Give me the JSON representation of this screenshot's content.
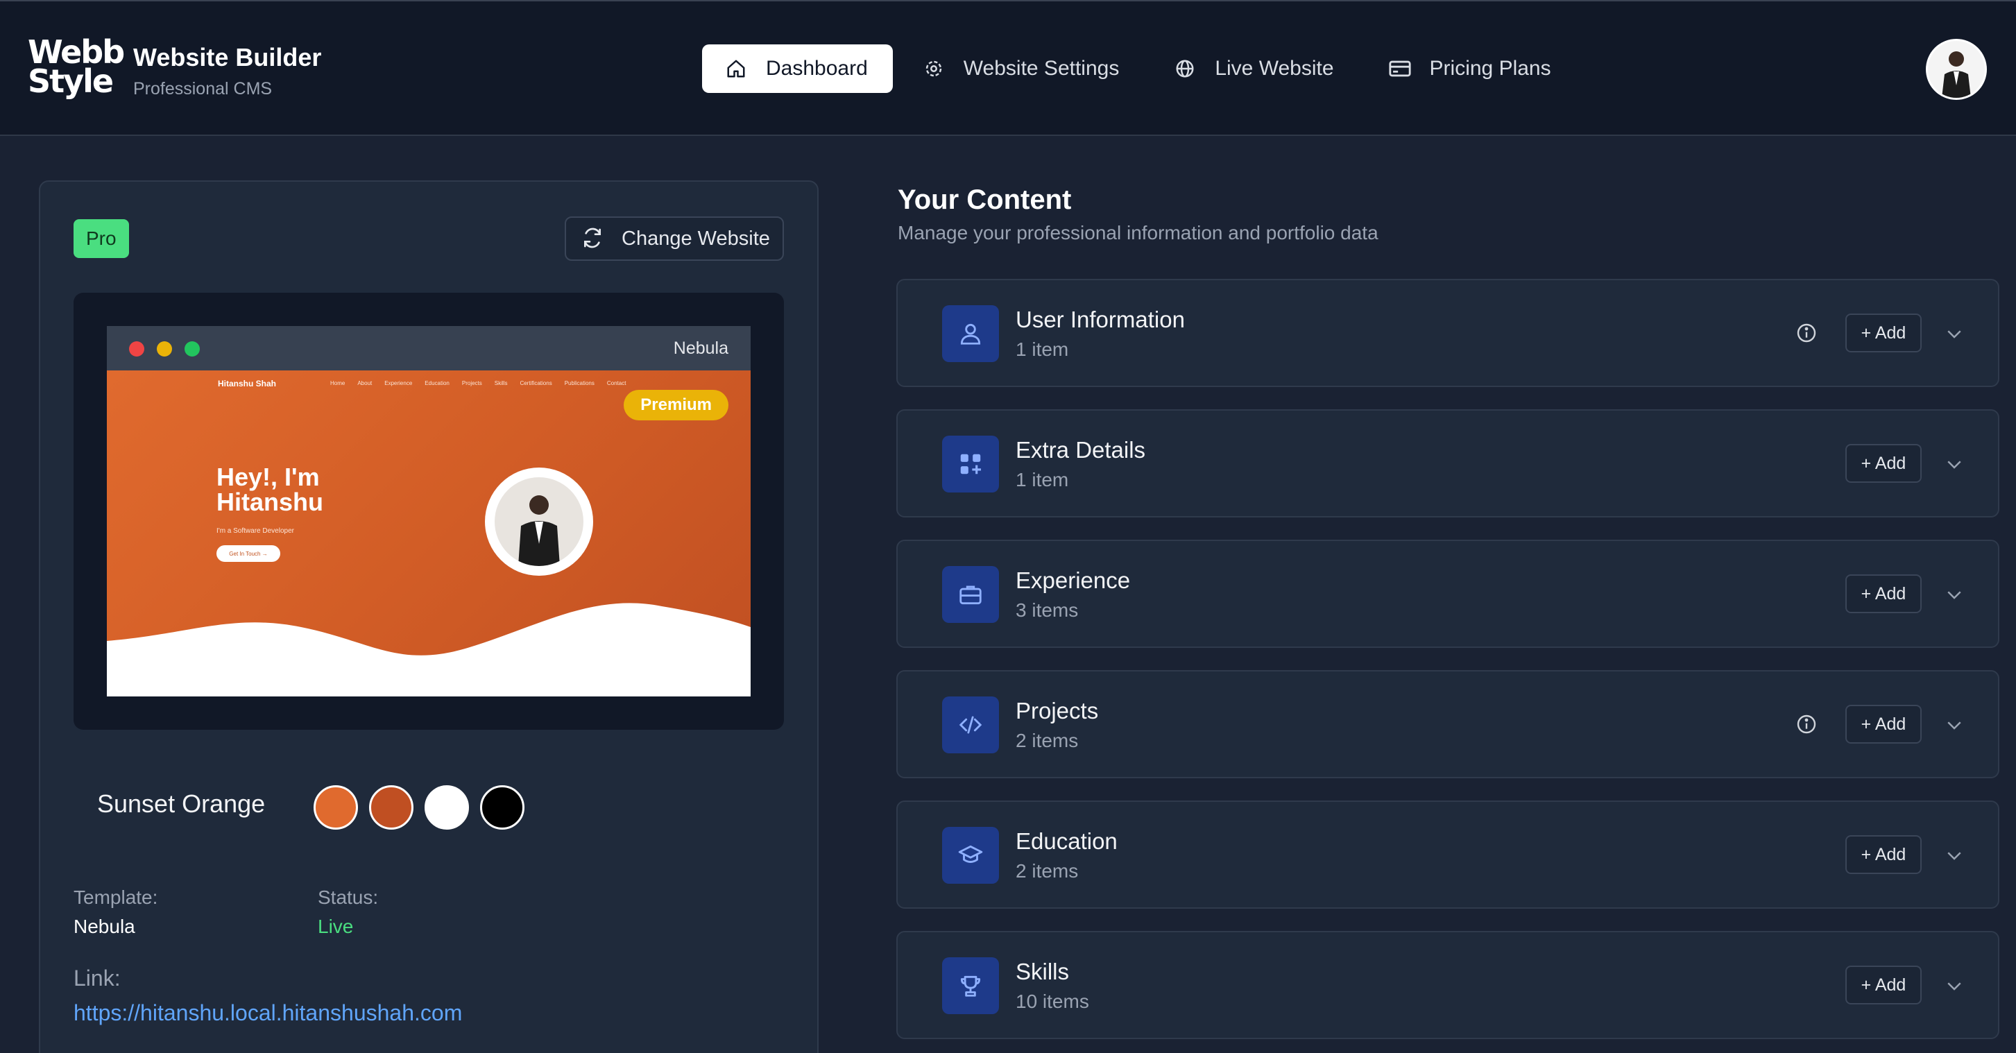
{
  "app": {
    "logo_line1": "Webb",
    "logo_line2": "Style",
    "title": "Website Builder",
    "subtitle": "Professional CMS"
  },
  "nav": [
    {
      "label": "Dashboard",
      "icon": "home-icon",
      "active": true
    },
    {
      "label": "Website Settings",
      "icon": "gear-icon",
      "active": false
    },
    {
      "label": "Live Website",
      "icon": "globe-icon",
      "active": false
    },
    {
      "label": "Pricing Plans",
      "icon": "credit-card-icon",
      "active": false
    }
  ],
  "website_panel": {
    "plan_badge": "Pro",
    "change_button": "Change Website",
    "preview": {
      "browser_label": "Nebula",
      "site_brand": "Hitanshu Shah",
      "site_nav": [
        "Home",
        "About",
        "Experience",
        "Education",
        "Projects",
        "Skills",
        "Certifications",
        "Publications",
        "Contact"
      ],
      "premium_badge": "Premium",
      "hero_title": "Hey!, I'm Hitanshu",
      "hero_subtitle": "I'm a Software Developer",
      "hero_button": "Get In Touch →"
    },
    "theme": {
      "name": "Sunset Orange",
      "colors": [
        "#e06a2e",
        "#c04f22",
        "#ffffff",
        "#000000"
      ]
    },
    "template_label": "Template:",
    "template_value": "Nebula",
    "status_label": "Status:",
    "status_value": "Live",
    "link_label": "Link:",
    "link_value": "https://hitanshu.local.hitanshushah.com"
  },
  "content": {
    "title": "Your Content",
    "subtitle": "Manage your professional information and portfolio data",
    "add_label": "+ Add",
    "sections": [
      {
        "title": "User Information",
        "count": "1 item",
        "icon": "user-icon",
        "has_info": true
      },
      {
        "title": "Extra Details",
        "count": "1 item",
        "icon": "grid-plus-icon",
        "has_info": false
      },
      {
        "title": "Experience",
        "count": "3 items",
        "icon": "briefcase-icon",
        "has_info": false
      },
      {
        "title": "Projects",
        "count": "2 items",
        "icon": "code-icon",
        "has_info": true
      },
      {
        "title": "Education",
        "count": "2 items",
        "icon": "graduation-cap-icon",
        "has_info": false
      },
      {
        "title": "Skills",
        "count": "10 items",
        "icon": "trophy-icon",
        "has_info": false
      }
    ]
  },
  "colors": {
    "background": "#1a2233",
    "header": "#111827",
    "card": "#1f2a3b",
    "accent_green": "#4ade80",
    "link_blue": "#60a5fa",
    "icon_tile": "#1e3a8a"
  }
}
